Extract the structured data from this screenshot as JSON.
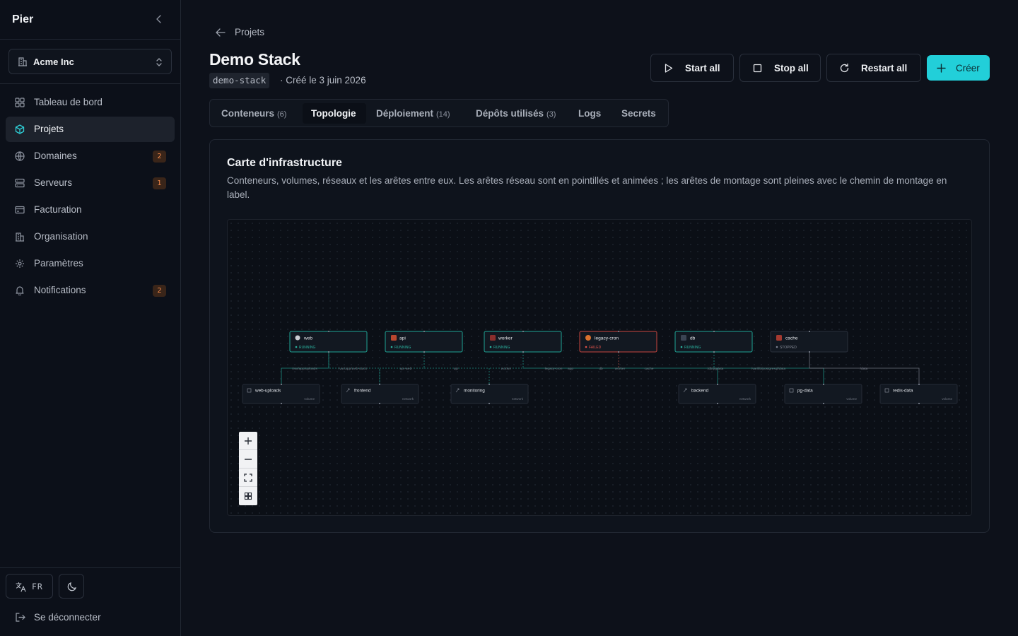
{
  "app": {
    "brand": "Pier"
  },
  "org": {
    "name": "Acme Inc"
  },
  "nav": {
    "items": [
      {
        "label": "Tableau de bord",
        "icon": "grid-icon"
      },
      {
        "label": "Projets",
        "icon": "box-icon",
        "active": true
      },
      {
        "label": "Domaines",
        "icon": "globe-icon",
        "badge": "2"
      },
      {
        "label": "Serveurs",
        "icon": "server-icon",
        "badge": "1"
      },
      {
        "label": "Facturation",
        "icon": "card-icon"
      },
      {
        "label": "Organisation",
        "icon": "building-icon"
      },
      {
        "label": "Paramètres",
        "icon": "gear-icon"
      },
      {
        "label": "Notifications",
        "icon": "bell-icon",
        "badge": "2"
      }
    ]
  },
  "footer": {
    "lang": "FR",
    "logout": "Se déconnecter"
  },
  "header": {
    "breadcrumb": "Projets",
    "title": "Demo Stack",
    "slug": "demo-stack",
    "created": "· Créé le 3 juin 2026"
  },
  "actions": {
    "start": "Start all",
    "stop": "Stop all",
    "restart": "Restart all",
    "create": "Créer"
  },
  "tabs": [
    {
      "label": "Conteneurs",
      "count": "(6)"
    },
    {
      "label": "Topologie",
      "count": "",
      "active": true
    },
    {
      "label": "Déploiement",
      "count": "(14)"
    },
    {
      "label": "Dépôts utilisés",
      "count": "(3)"
    },
    {
      "label": "Logs",
      "count": ""
    },
    {
      "label": "Secrets",
      "count": ""
    }
  ],
  "card": {
    "title": "Carte d'infrastructure",
    "description": "Conteneurs, volumes, réseaux et les arêtes entre eux. Les arêtes réseau sont en pointillés et animées ; les arêtes de montage sont pleines avec le chemin de montage en label."
  },
  "topology": {
    "containers": [
      {
        "name": "web",
        "status": "RUNNING"
      },
      {
        "name": "api",
        "status": "RUNNING"
      },
      {
        "name": "worker",
        "status": "RUNNING"
      },
      {
        "name": "legacy-cron",
        "status": "FAILED"
      },
      {
        "name": "db",
        "status": "RUNNING"
      },
      {
        "name": "cache",
        "status": "STOPPED"
      }
    ],
    "resources": [
      {
        "name": "web-uploads",
        "kind": "volume"
      },
      {
        "name": "frontend",
        "kind": "network"
      },
      {
        "name": "monitoring",
        "kind": "network"
      },
      {
        "name": "backend",
        "kind": "network"
      },
      {
        "name": "pg-data",
        "kind": "volume"
      },
      {
        "name": "redis-data",
        "kind": "volume"
      }
    ],
    "edge_labels": [
      "/var/app/uploads",
      "/var/app/web-stack",
      "api-web",
      "api",
      "worker",
      "legacy-cron",
      "app",
      "db",
      "worker",
      "cache",
      "/db/pgdata",
      "/var/lib/postgresql/data",
      "/data"
    ],
    "status_colors": {
      "RUNNING": "#2bb3a0",
      "FAILED": "#e0524a",
      "STOPPED": "#7d8290"
    }
  }
}
